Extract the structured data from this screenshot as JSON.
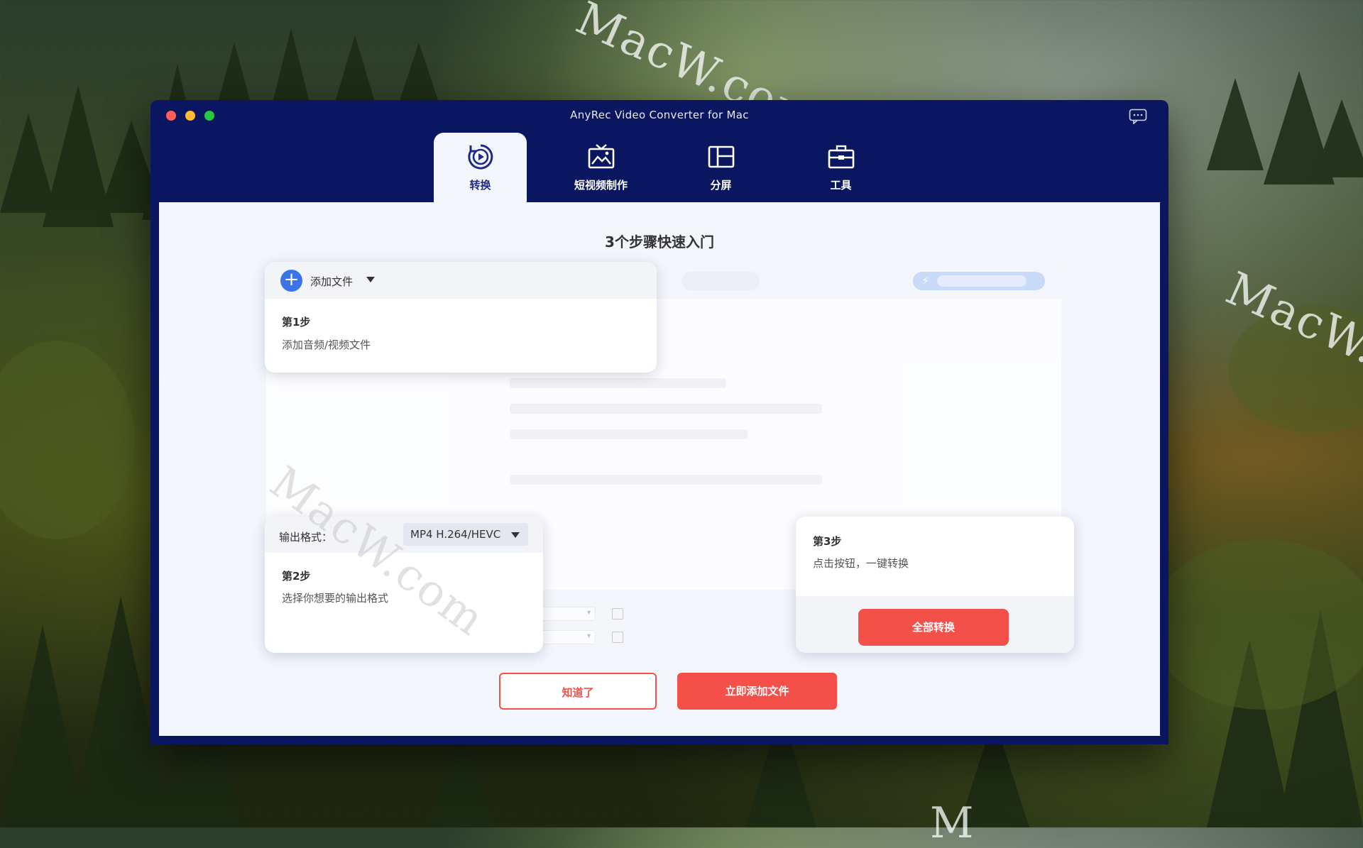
{
  "window": {
    "title": "AnyRec Video Converter for Mac"
  },
  "tabs": [
    {
      "label": "转换",
      "icon": "convert-icon",
      "active": true
    },
    {
      "label": "短视频制作",
      "icon": "mv-icon",
      "active": false
    },
    {
      "label": "分屏",
      "icon": "collage-icon",
      "active": false
    },
    {
      "label": "工具",
      "icon": "toolbox-icon",
      "active": false
    }
  ],
  "guide": {
    "title": "3个步骤快速入门",
    "step1": {
      "add_label": "添加文件",
      "title": "第1步",
      "desc": "添加音频/视频文件"
    },
    "step2": {
      "format_label": "输出格式：",
      "format_value": "MP4 H.264/HEVC",
      "title": "第2步",
      "desc": "选择你想要的输出格式"
    },
    "step3": {
      "title": "第3步",
      "desc": "点击按钮，一键转换",
      "convert_all": "全部转换"
    },
    "buttons": {
      "got_it": "知道了",
      "add_now": "立即添加文件"
    }
  },
  "watermarks": [
    "MacW.com",
    "MacW.c",
    "MacW.com",
    "M"
  ],
  "colors": {
    "window_bg": "#0b1660",
    "accent_red": "#f4504a",
    "accent_blue": "#3b73e8",
    "content_bg": "#f3f6fb"
  }
}
